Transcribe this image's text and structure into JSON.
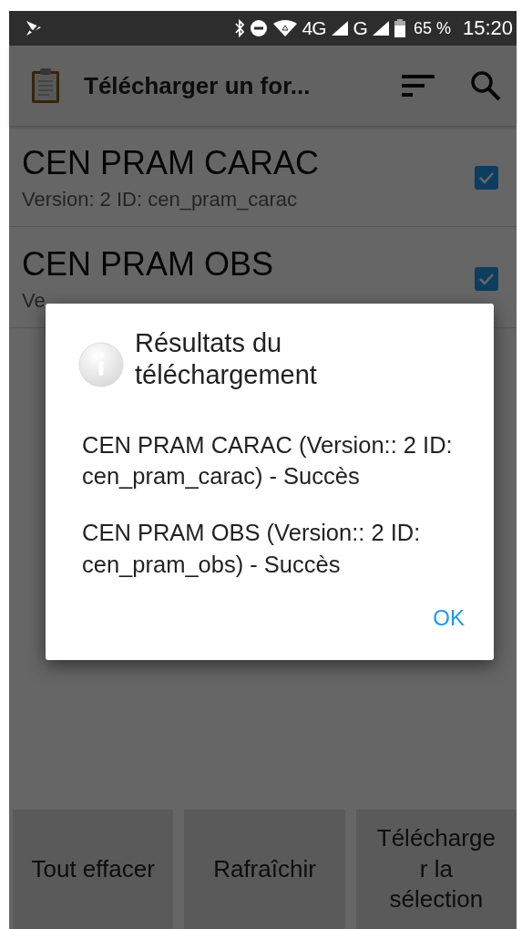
{
  "status_bar": {
    "network_4g": "4G",
    "network_g": "G",
    "battery": "65 %",
    "time": "15:20"
  },
  "toolbar": {
    "title": "Télécharger un for..."
  },
  "forms": [
    {
      "name": "CEN PRAM CARAC",
      "details": "Version: 2 ID: cen_pram_carac",
      "checked": true
    },
    {
      "name": "CEN PRAM OBS",
      "details": "Ve",
      "checked": true
    }
  ],
  "dialog": {
    "title": "Résultats du téléchargement",
    "messages": [
      "CEN PRAM CARAC (Version:: 2 ID: cen_pram_carac) - Succès",
      "CEN PRAM OBS (Version:: 2 ID: cen_pram_obs) - Succès"
    ],
    "button": "OK"
  },
  "buttons": [
    "Tout effacer",
    "Rafraîchir",
    "Télécharge r la sélection"
  ]
}
